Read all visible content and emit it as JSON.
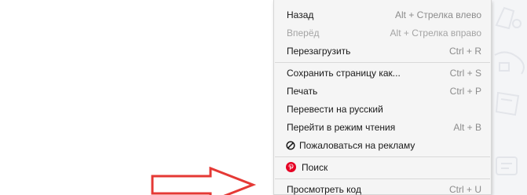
{
  "colors": {
    "menu_background": "#f5f5f5",
    "menu_text": "#1a1a1a",
    "shortcut_text": "#8c8c8c",
    "disabled_text": "#a4a4a4",
    "separator": "#d9d9d9",
    "pinterest_red": "#e60023",
    "arrow_outline": "#e53935"
  },
  "context_menu": {
    "items": [
      {
        "label": "Назад",
        "shortcut": "Alt + Стрелка влево",
        "enabled": true
      },
      {
        "label": "Вперёд",
        "shortcut": "Alt + Стрелка вправо",
        "enabled": false
      },
      {
        "label": "Перезагрузить",
        "shortcut": "Ctrl + R",
        "enabled": true
      },
      {
        "label": "Сохранить страницу как...",
        "shortcut": "Ctrl + S",
        "enabled": true
      },
      {
        "label": "Печать",
        "shortcut": "Ctrl + P",
        "enabled": true
      },
      {
        "label": "Перевести на русский",
        "shortcut": "",
        "enabled": true
      },
      {
        "label": "Перейти в режим чтения",
        "shortcut": "Alt + B",
        "enabled": true
      },
      {
        "label": "Пожаловаться на рекламу",
        "shortcut": "",
        "enabled": true,
        "icon": "block-icon"
      },
      {
        "label": "Поиск",
        "shortcut": "",
        "enabled": true,
        "icon": "pinterest-icon"
      },
      {
        "label": "Просмотреть код",
        "shortcut": "Ctrl + U",
        "enabled": true
      }
    ]
  }
}
